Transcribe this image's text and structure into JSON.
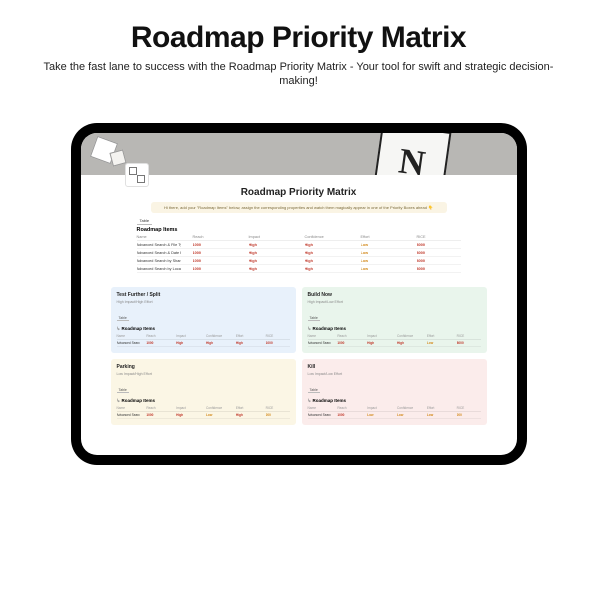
{
  "hero": {
    "title": "Roadmap Priority Matrix",
    "subtitle": "Take the fast lane to success with the Roadmap Priority Matrix - Your tool for swift and strategic decision-making!"
  },
  "cover": {
    "logo_letter": "N"
  },
  "page": {
    "title": "Roadmap Priority Matrix",
    "callout": "Hi there, add your \"Roadmap Items\" below, assign the corresponding properties and watch them magically appear in one of the Priority Boxes ahead 👇",
    "table_tab": "Table",
    "db_name": "Roadmap Items",
    "columns": [
      "Name",
      "Reach",
      "Impact",
      "Confidence",
      "Effort",
      "RICE"
    ],
    "rows": [
      {
        "name": "Advanced Search & File Types",
        "reach": "1000",
        "impact": "High",
        "confidence": "High",
        "effort": "Low",
        "rice": "8000"
      },
      {
        "name": "Advanced Search & Date Range",
        "reach": "1000",
        "impact": "High",
        "confidence": "High",
        "effort": "Low",
        "rice": "8000"
      },
      {
        "name": "Advanced Search by Shared",
        "reach": "1000",
        "impact": "High",
        "confidence": "High",
        "effort": "Low",
        "rice": "8000"
      },
      {
        "name": "Advanced Search by Location",
        "reach": "1000",
        "impact": "High",
        "confidence": "High",
        "effort": "Low",
        "rice": "8000"
      }
    ]
  },
  "quadrants": {
    "top_left": {
      "title": "Test Further / Split",
      "hint": "High Impact/High Effort",
      "tab": "Table",
      "db": "Roadmap Items",
      "cols": [
        "Name",
        "Reach",
        "Impact",
        "Confidence",
        "Effort",
        "RICE"
      ],
      "rows": [
        {
          "name": "Advanced Search & File Types",
          "reach": "1000",
          "impact": "High",
          "confidence": "High",
          "effort": "High",
          "rice": "1000"
        }
      ]
    },
    "top_right": {
      "title": "Build Now",
      "hint": "High Impact/Low Effort",
      "tab": "Table",
      "db": "Roadmap Items",
      "cols": [
        "Name",
        "Reach",
        "Impact",
        "Confidence",
        "Effort",
        "RICE"
      ],
      "rows": [
        {
          "name": "Advanced Search & Date Range",
          "reach": "1000",
          "impact": "High",
          "confidence": "High",
          "effort": "Low",
          "rice": "8000"
        }
      ]
    },
    "bottom_left": {
      "title": "Parking",
      "hint": "Low Impact/High Effort",
      "tab": "Table",
      "db": "Roadmap Items",
      "cols": [
        "Name",
        "Reach",
        "Impact",
        "Confidence",
        "Effort",
        "RICE"
      ],
      "rows": [
        {
          "name": "Advanced Search by Shared",
          "reach": "1000",
          "impact": "High",
          "confidence": "Low",
          "effort": "High",
          "rice": "200"
        }
      ]
    },
    "bottom_right": {
      "title": "Kill",
      "hint": "Low Impact/Low Effort",
      "tab": "Table",
      "db": "Roadmap Items",
      "cols": [
        "Name",
        "Reach",
        "Impact",
        "Confidence",
        "Effort",
        "RICE"
      ],
      "rows": [
        {
          "name": "Advanced Search by Location",
          "reach": "1000",
          "impact": "Low",
          "confidence": "Low",
          "effort": "Low",
          "rice": "200"
        }
      ]
    }
  }
}
